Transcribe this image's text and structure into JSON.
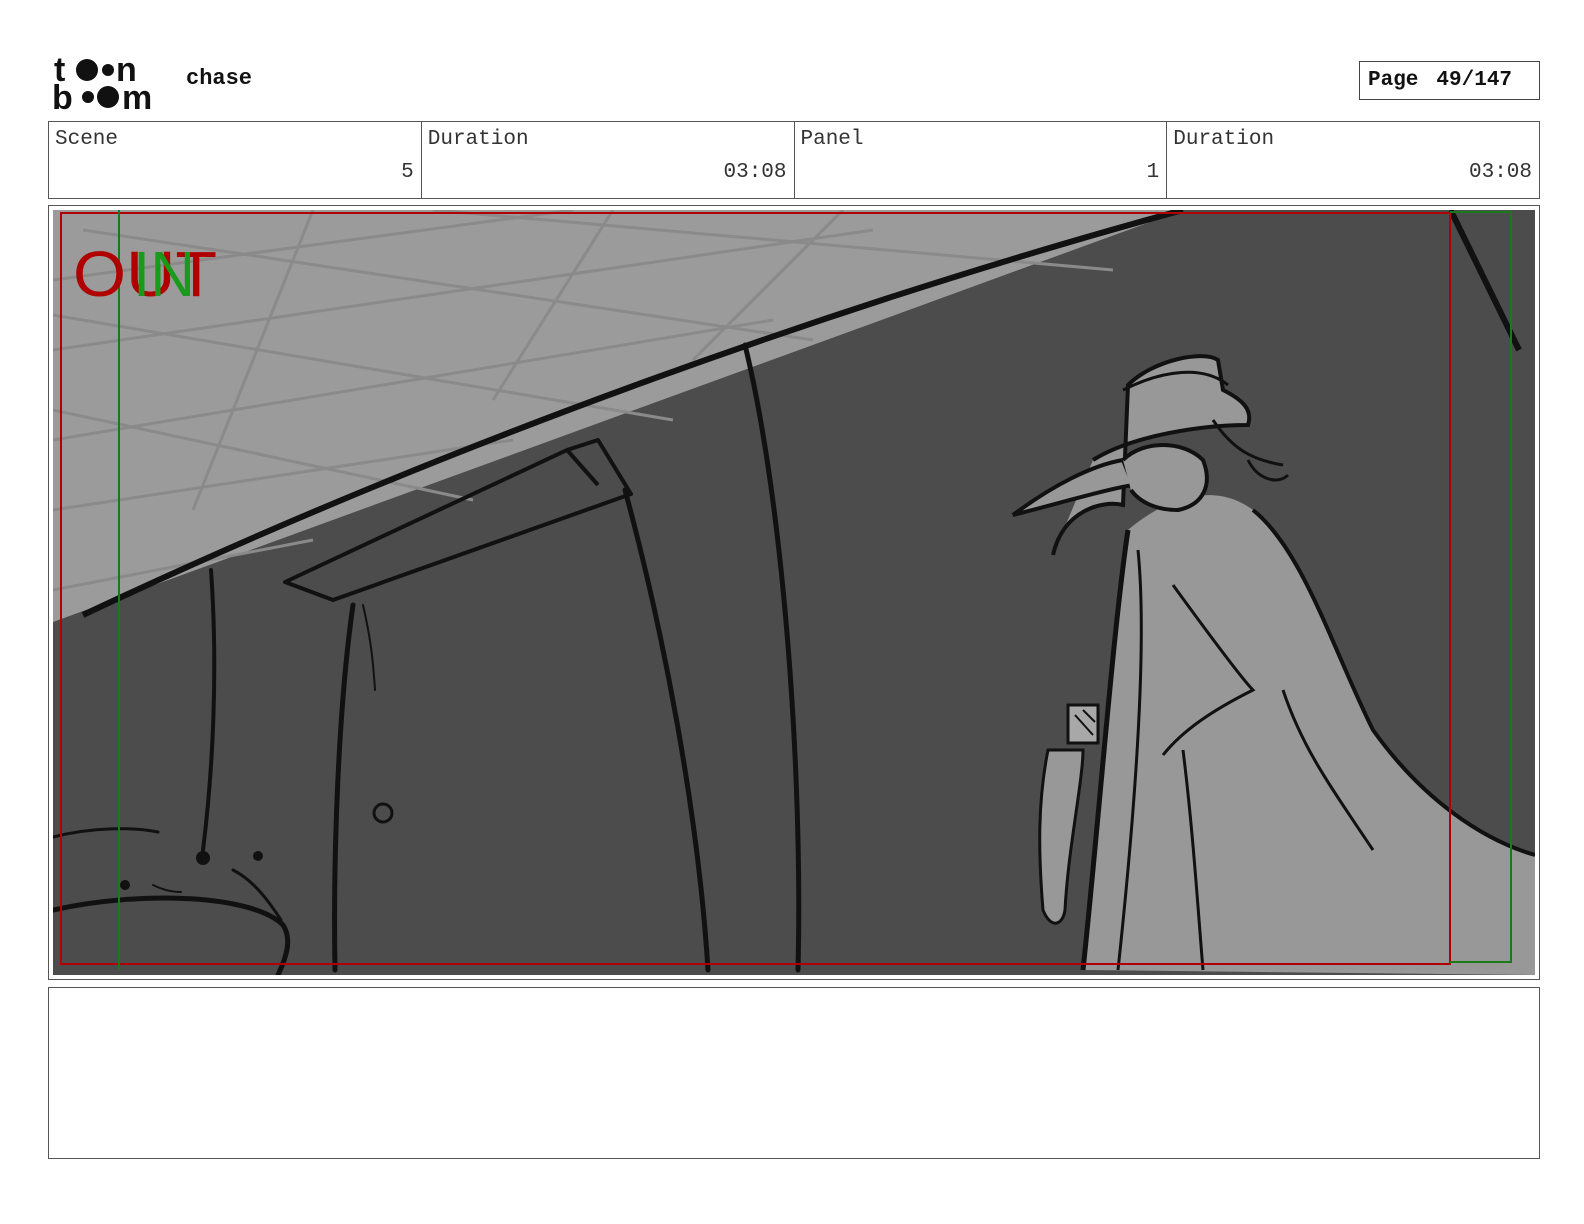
{
  "header": {
    "logo": {
      "line1": "toon",
      "line2": "boom",
      "name": "toon-boom-logo"
    },
    "project_title": "chase",
    "page": {
      "label": "Page",
      "value": "49/147"
    }
  },
  "info": {
    "scene": {
      "label": "Scene",
      "value": "5"
    },
    "scene_duration": {
      "label": "Duration",
      "value": "03:08"
    },
    "panel": {
      "label": "Panel",
      "value": "1"
    },
    "panel_duration": {
      "label": "Duration",
      "value": "03:08"
    }
  },
  "panel": {
    "overlay": {
      "out_text": "OUT",
      "in_text": "IN",
      "out_color": "#b00000",
      "in_color": "#1a9a1a"
    },
    "colors": {
      "wall": "#4c4c4c",
      "ceiling": "#9b9b9b",
      "figure": "#989898",
      "ink": "#111111"
    }
  },
  "notes": {
    "text": ""
  }
}
